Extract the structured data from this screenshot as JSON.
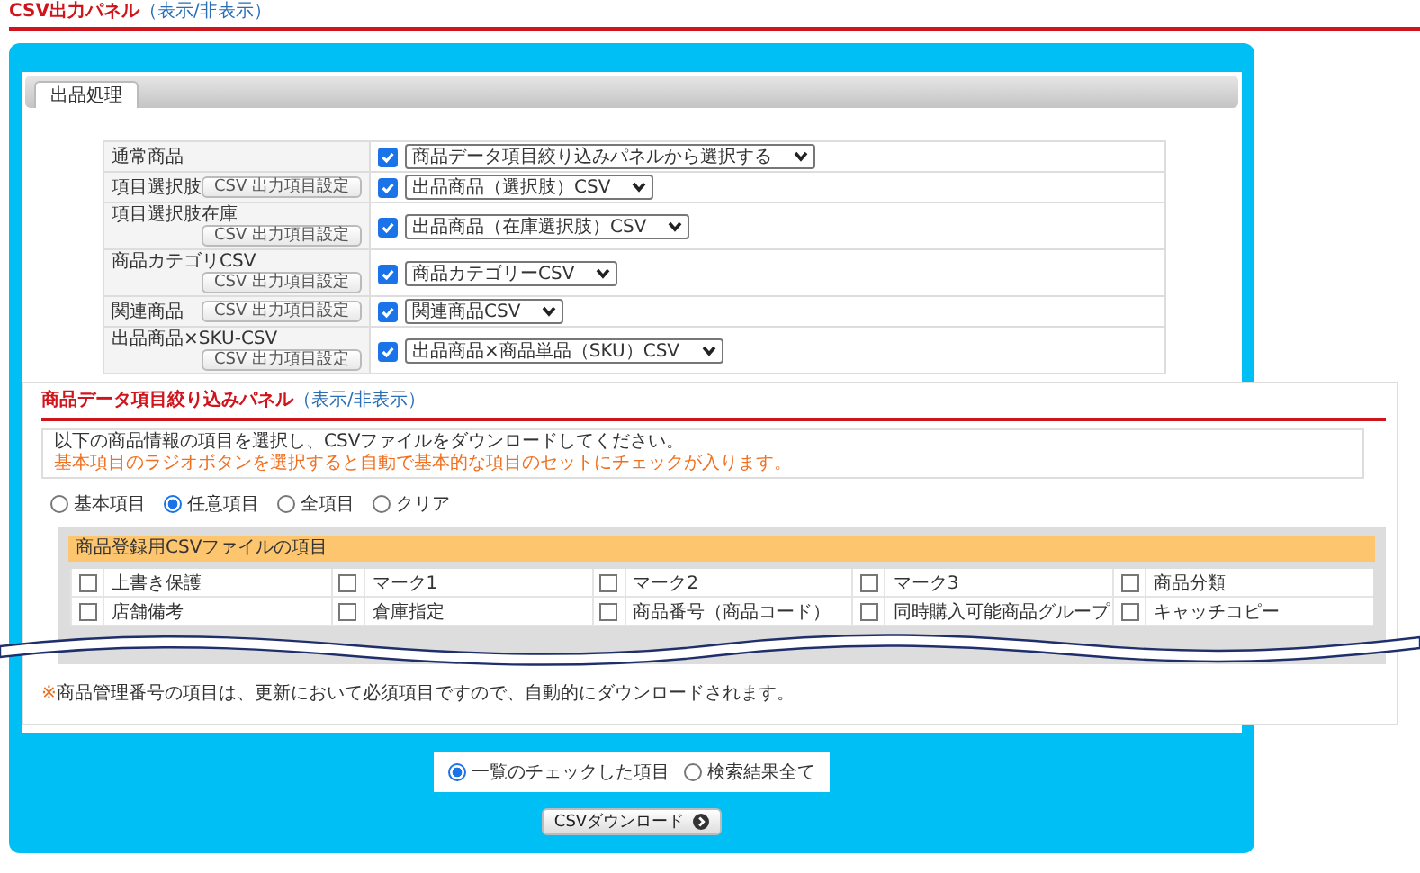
{
  "header": {
    "title": "CSV出力パネル",
    "toggle_link": "（表示/非表示）"
  },
  "tabs": [
    {
      "label": "出品処理",
      "selected": true
    }
  ],
  "export_rows": [
    {
      "label": "通常商品",
      "kind": "plain",
      "checked": true,
      "option": "商品データ項目絞り込みパネルから選択する"
    },
    {
      "label": "項目選択肢",
      "kind": "inline",
      "settings_button": "CSV 出力項目設定",
      "checked": true,
      "option": "出品商品（選択肢）CSV"
    },
    {
      "label": "項目選択肢在庫",
      "kind": "stacked",
      "settings_button": "CSV 出力項目設定",
      "checked": true,
      "option": "出品商品（在庫選択肢）CSV"
    },
    {
      "label": "商品カテゴリCSV",
      "kind": "stacked",
      "settings_button": "CSV 出力項目設定",
      "checked": true,
      "option": "商品カテゴリーCSV"
    },
    {
      "label": "関連商品",
      "kind": "inline",
      "settings_button": "CSV 出力項目設定",
      "checked": true,
      "option": "関連商品CSV"
    },
    {
      "label": "出品商品×SKU-CSV",
      "kind": "stacked",
      "settings_button": "CSV 出力項目設定",
      "checked": true,
      "option": "出品商品×商品単品（SKU）CSV"
    }
  ],
  "filter_panel": {
    "title": "商品データ項目絞り込みパネル",
    "toggle_link": "（表示/非表示）",
    "info_lines": [
      {
        "kind": "normal",
        "text": "以下の商品情報の項目を選択し、CSVファイルをダウンロードしてください。"
      },
      {
        "kind": "notice",
        "text": "基本項目のラジオボタンを選択すると自動で基本的な項目のセットにチェックが入ります。"
      }
    ],
    "presets": [
      {
        "label": "基本項目",
        "selected": false
      },
      {
        "label": "任意項目",
        "selected": true
      },
      {
        "label": "全項目",
        "selected": false
      },
      {
        "label": "クリア",
        "selected": false
      }
    ],
    "group_title": "商品登録用CSVファイルの項目",
    "field_rows": [
      [
        {
          "label": "上書き保護",
          "checked": false
        },
        {
          "label": "マーク1",
          "checked": false
        },
        {
          "label": "マーク2",
          "checked": false
        },
        {
          "label": "マーク3",
          "checked": false
        },
        {
          "label": "商品分類",
          "checked": false
        }
      ],
      [
        {
          "label": "店舗備考",
          "checked": false
        },
        {
          "label": "倉庫指定",
          "checked": false
        },
        {
          "label": "商品番号（商品コード）",
          "checked": false
        },
        {
          "label": "同時購入可能商品グループ",
          "checked": false
        },
        {
          "label": "キャッチコピー",
          "checked": false
        }
      ]
    ],
    "note_mark": "※",
    "note": "商品管理番号の項目は、更新において必須項目ですので、自動的にダウンロードされます。"
  },
  "scope_options": [
    {
      "label": "一覧のチェックした項目",
      "selected": true
    },
    {
      "label": "検索結果全て",
      "selected": false
    }
  ],
  "download_button": "CSVダウンロード"
}
